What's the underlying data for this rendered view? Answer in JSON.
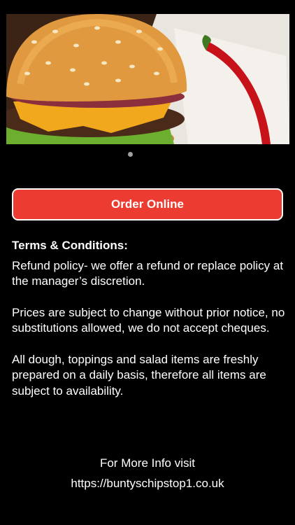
{
  "hero": {
    "image_name": "burger-photo"
  },
  "pager": {
    "count": 1,
    "active": 1
  },
  "order_button": {
    "label": "Order Online",
    "color": "#ec3c32"
  },
  "terms": {
    "title": "Terms & Conditions:",
    "paragraphs": [
      "Refund policy- we offer a refund or replace policy at the manager’s discretion.",
      "Prices are subject to change without prior notice, no substitutions allowed, we do not accept cheques.",
      "All dough, toppings and salad items are freshly prepared on a daily basis, therefore all items are subject to availability."
    ]
  },
  "footer": {
    "info_text": "For More Info visit",
    "url": "https://buntyschipstop1.co.uk"
  }
}
